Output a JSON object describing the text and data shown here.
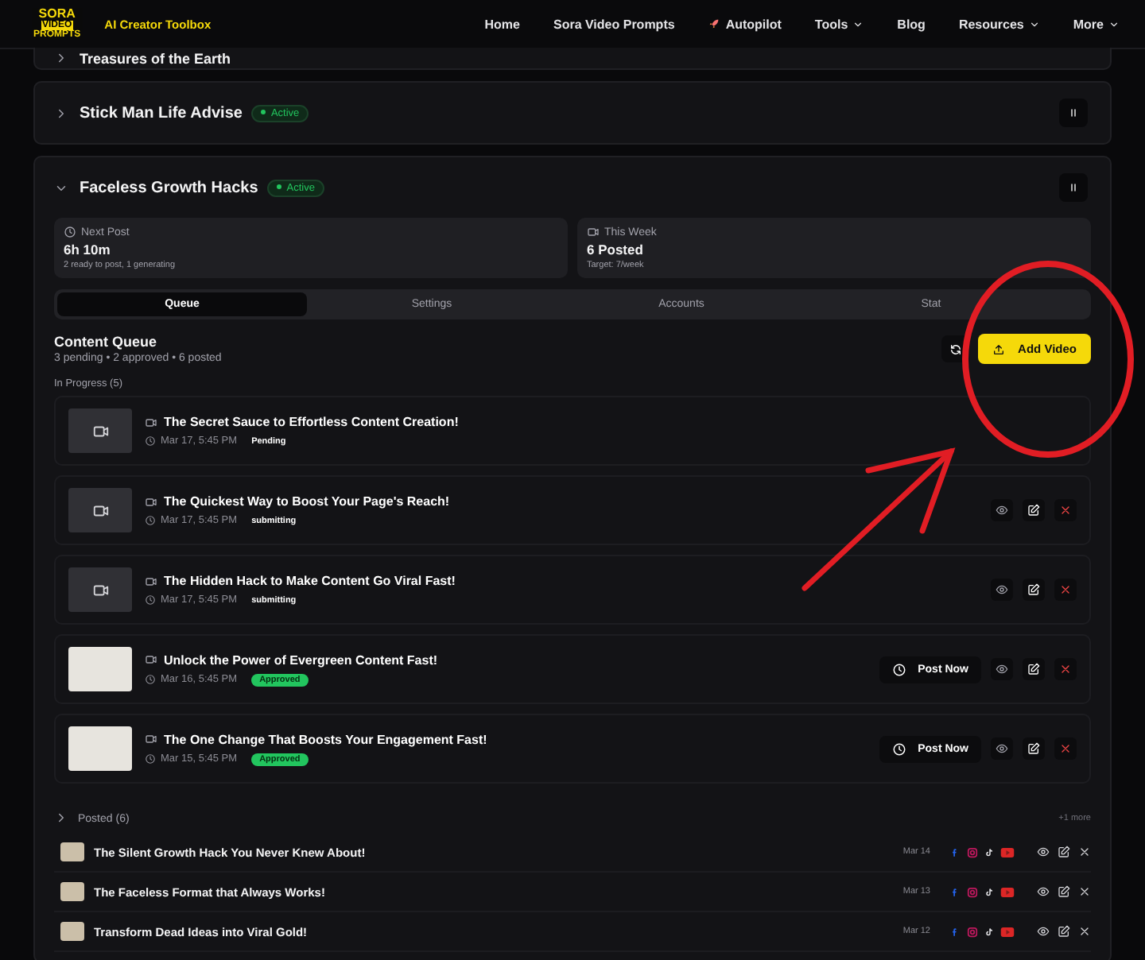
{
  "header": {
    "logo": [
      "SORA",
      "VIDEO",
      "PROMPTS"
    ],
    "tagline": "AI Creator Toolbox",
    "nav": [
      {
        "label": "Home",
        "kind": "link"
      },
      {
        "label": "Sora Video Prompts",
        "kind": "link"
      },
      {
        "label": "Autopilot",
        "kind": "rocket"
      },
      {
        "label": "Tools",
        "kind": "dropdown"
      },
      {
        "label": "Blog",
        "kind": "link"
      },
      {
        "label": "Resources",
        "kind": "dropdown"
      },
      {
        "label": "More",
        "kind": "dropdown"
      }
    ]
  },
  "campaigns": [
    {
      "title": "Treasures of the Earth",
      "expanded": false
    },
    {
      "title": "Stick Man Life Advise",
      "status": "Active",
      "expanded": false
    },
    {
      "title": "Faceless Growth Hacks",
      "status": "Active",
      "expanded": true,
      "stats": [
        {
          "kind": "clock",
          "label": "Next Post",
          "value": "6h 10m",
          "note": "2 ready to post, 1 generating"
        },
        {
          "kind": "video",
          "label": "This Week",
          "value": "6 Posted",
          "note": "Target: 7/week"
        }
      ],
      "tabs": [
        {
          "label": "Queue",
          "selected": true
        },
        {
          "label": "Settings",
          "selected": false
        },
        {
          "label": "Accounts",
          "selected": false
        },
        {
          "label": "Stat",
          "selected": false
        }
      ],
      "queue": {
        "title": "Content Queue",
        "summary": "3 pending • 2 approved • 6 posted",
        "add_button": "Add Video",
        "section": "In Progress (5)",
        "items": [
          {
            "kind": "placeholder",
            "title": "The Secret Sauce to Effortless Content Creation!",
            "time": "Mar 17, 5:45 PM",
            "badge": {
              "label": "Pending"
            },
            "has_actions": false
          },
          {
            "kind": "placeholder",
            "title": "The Quickest Way to Boost Your Page's Reach!",
            "time": "Mar 17, 5:45 PM",
            "badge": {
              "label": "submitting"
            },
            "has_actions": true
          },
          {
            "kind": "placeholder",
            "title": "The Hidden Hack to Make Content Go Viral Fast!",
            "time": "Mar 17, 5:45 PM",
            "badge": {
              "label": "submitting"
            },
            "has_actions": true
          },
          {
            "kind": "image",
            "title": "Unlock the Power of Evergreen Content Fast!",
            "time": "Mar 16, 5:45 PM",
            "badge": {
              "label": "Approved",
              "color": "#22c55e"
            },
            "post_now": "Post Now",
            "has_actions": true
          },
          {
            "kind": "image",
            "title": "The One Change That Boosts Your Engagement Fast!",
            "time": "Mar 15, 5:45 PM",
            "badge": {
              "label": "Approved",
              "color": "#22c55e"
            },
            "post_now": "Post Now",
            "has_actions": true
          }
        ]
      },
      "posted": {
        "title": "Posted (6)",
        "expanded": false,
        "more": "+1 more",
        "items": [
          {
            "title": "The Silent Growth Hack You Never Knew About!",
            "date": "Mar 14",
            "platforms": [
              {
                "kind": "facebook"
              },
              {
                "kind": "instagram"
              },
              {
                "kind": "tiktok"
              },
              {
                "kind": "youtube"
              }
            ]
          },
          {
            "title": "The Faceless Format that Always Works!",
            "date": "Mar 13",
            "platforms": [
              {
                "kind": "facebook"
              },
              {
                "kind": "instagram"
              },
              {
                "kind": "tiktok"
              },
              {
                "kind": "youtube"
              }
            ]
          },
          {
            "title": "Transform Dead Ideas into Viral Gold!",
            "date": "Mar 12",
            "platforms": [
              {
                "kind": "facebook"
              },
              {
                "kind": "instagram"
              },
              {
                "kind": "tiktok"
              },
              {
                "kind": "youtube"
              }
            ]
          }
        ]
      }
    }
  ]
}
